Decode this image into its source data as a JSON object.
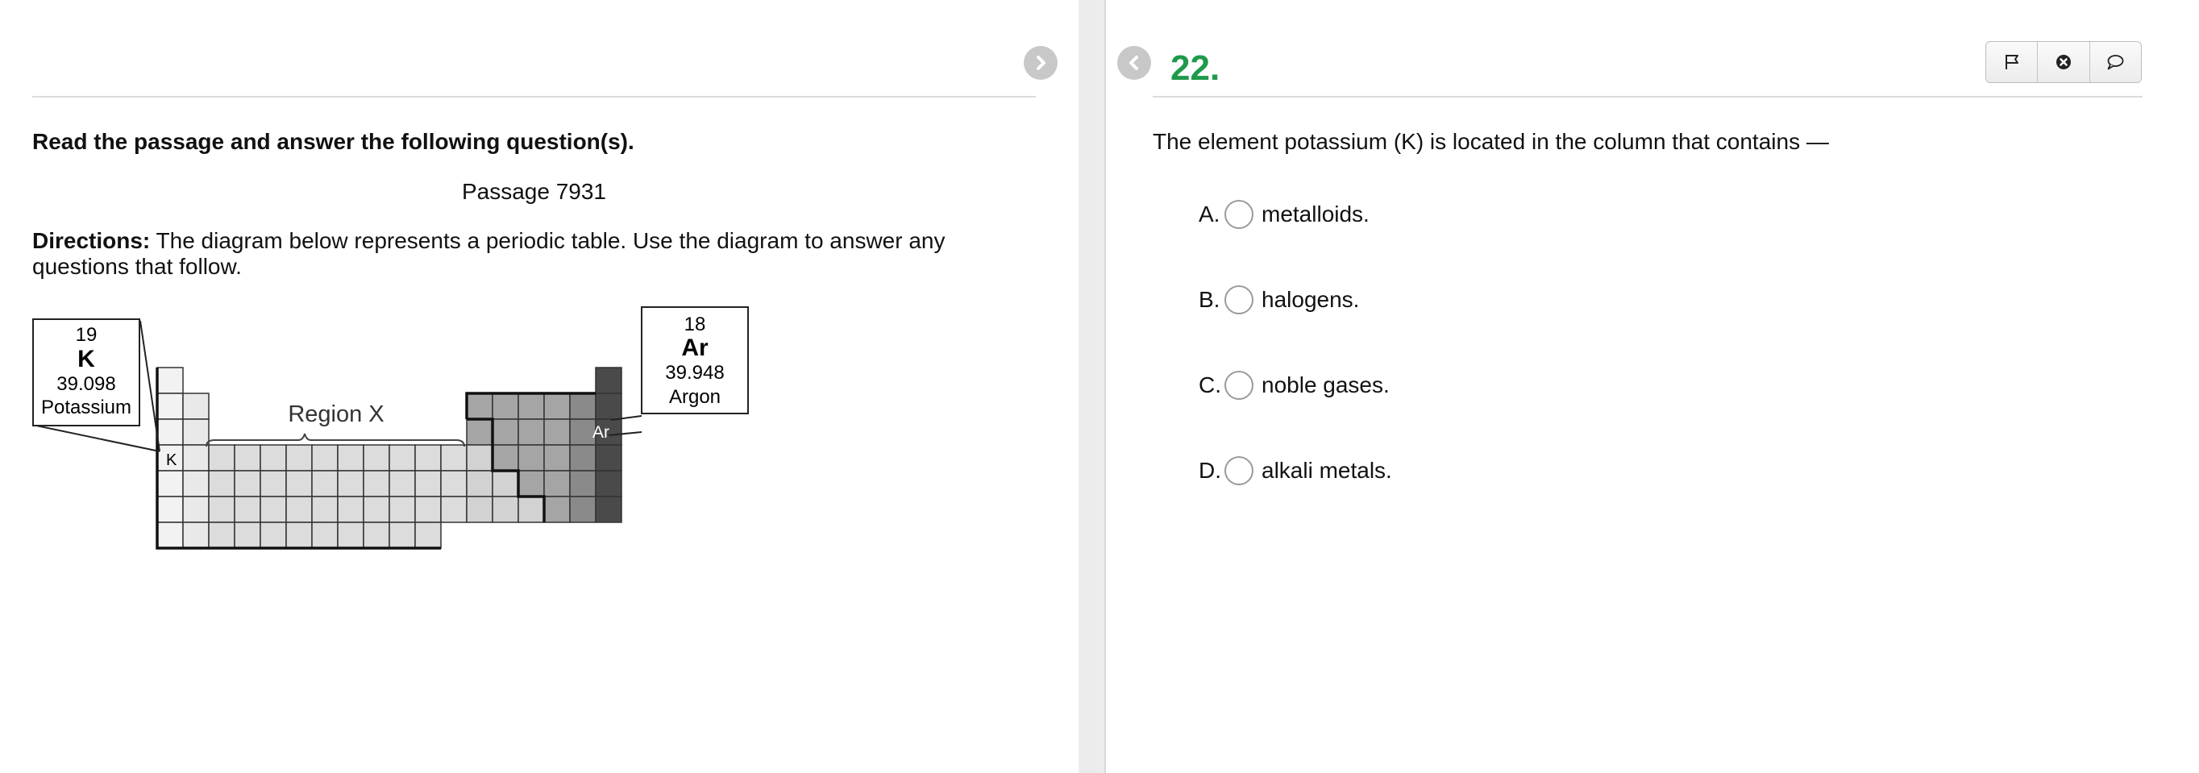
{
  "passage": {
    "instruction": "Read the passage and answer the following question(s).",
    "title": "Passage 7931",
    "directions_label": "Directions:",
    "directions_text": "The diagram below represents a periodic table. Use the diagram to answer any questions that follow.",
    "diagram": {
      "region_label": "Region X",
      "cell_k_label": "K",
      "cell_ar_label": "Ar",
      "potassium": {
        "number": "19",
        "symbol": "K",
        "mass": "39.098",
        "name": "Potassium"
      },
      "argon": {
        "number": "18",
        "symbol": "Ar",
        "mass": "39.948",
        "name": "Argon"
      }
    }
  },
  "navigation": {
    "next_icon": "chevron-right-icon",
    "prev_icon": "chevron-left-icon"
  },
  "question": {
    "number": "22.",
    "text": "The element potassium (K) is located in the column that contains —",
    "choices": [
      {
        "letter": "A.",
        "text": "metalloids."
      },
      {
        "letter": "B.",
        "text": "halogens."
      },
      {
        "letter": "C.",
        "text": "noble gases."
      },
      {
        "letter": "D.",
        "text": "alkali metals."
      }
    ]
  },
  "toolbar": {
    "icons": [
      "flag-icon",
      "eliminate-icon",
      "comment-icon"
    ]
  },
  "colors": {
    "question_number": "#1f9a4a",
    "nav_button": "#c8c8c8"
  }
}
